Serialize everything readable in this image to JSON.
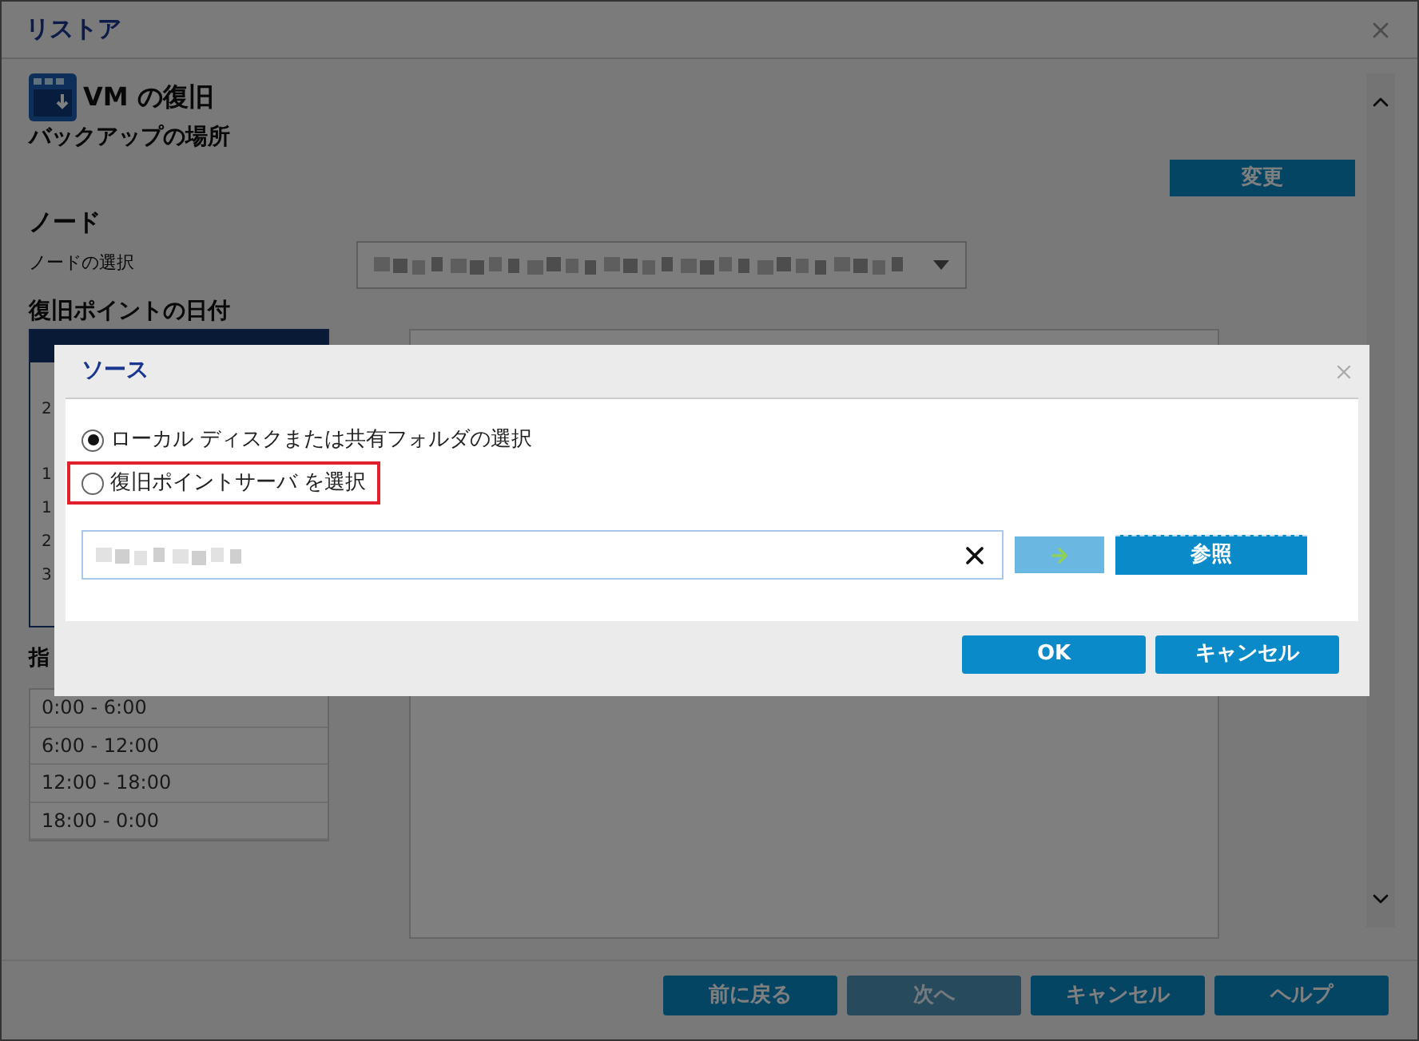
{
  "window": {
    "title": "リストア"
  },
  "header": {
    "title": "VM の復旧",
    "subtitle": "バックアップの場所",
    "change_button": "変更"
  },
  "node": {
    "heading": "ノード",
    "label": "ノードの選択"
  },
  "recovery_date": {
    "heading": "復旧ポイントの日付",
    "calendar_column_1": [
      "2",
      "1",
      "1",
      "2",
      "3"
    ],
    "time_heading": "指",
    "time_ranges": [
      "0:00 - 6:00",
      "6:00 - 12:00",
      "12:00 - 18:00",
      "18:00 - 0:00"
    ]
  },
  "footer_buttons": [
    {
      "label": "前に戻る",
      "disabled": false
    },
    {
      "label": "次へ",
      "disabled": true
    },
    {
      "label": "キャンセル",
      "disabled": false
    },
    {
      "label": "ヘルプ",
      "disabled": false
    }
  ],
  "dialog": {
    "title": "ソース",
    "options": [
      {
        "label": "ローカル ディスクまたは共有フォルダの選択",
        "selected": true,
        "highlighted": false
      },
      {
        "label": "復旧ポイントサーバ を選択",
        "selected": false,
        "highlighted": true
      }
    ],
    "browse_button": "参照",
    "buttons": [
      "OK",
      "キャンセル"
    ]
  }
}
